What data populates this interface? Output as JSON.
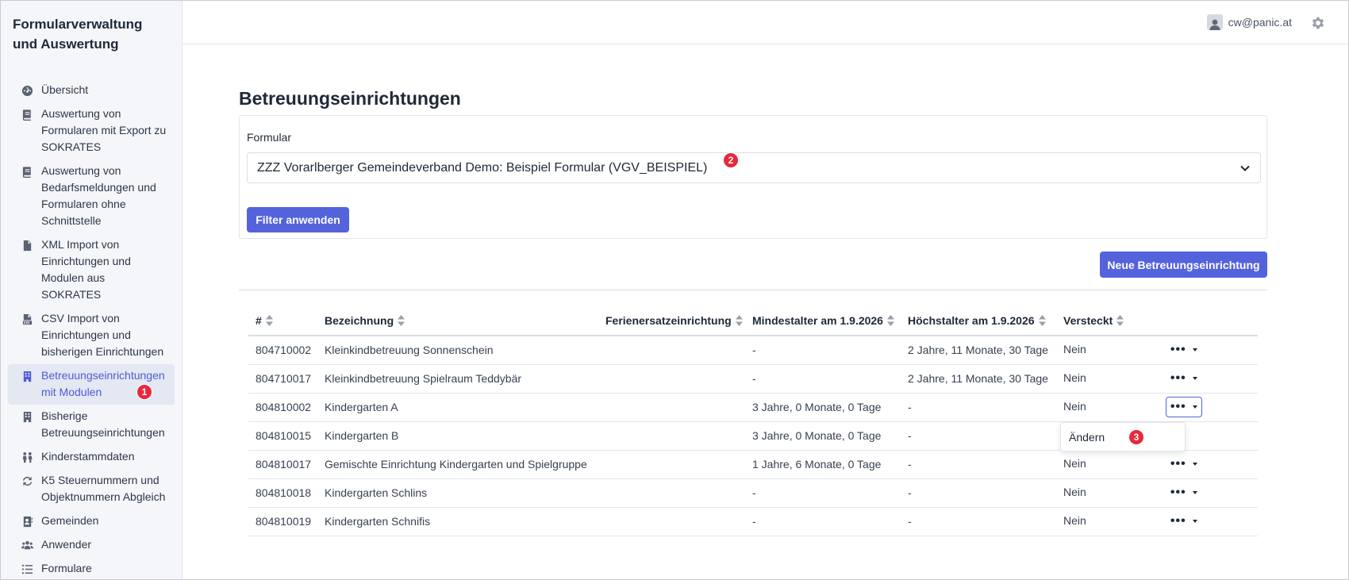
{
  "app": {
    "title": "Formularverwaltung und Auswertung"
  },
  "sidebar": {
    "items": [
      {
        "label": "Übersicht",
        "icon": "dashboard-icon"
      },
      {
        "label": "Auswertung von Formularen mit Export zu SOKRATES",
        "icon": "book-icon"
      },
      {
        "label": "Auswertung von Bedarfsmeldungen und Formularen ohne Schnittstelle",
        "icon": "book-icon"
      },
      {
        "label": "XML Import von Einrichtungen und Modulen aus SOKRATES",
        "icon": "file-code-icon"
      },
      {
        "label": "CSV Import von Einrichtungen und bisherigen Einrichtungen",
        "icon": "file-csv-icon"
      },
      {
        "label": "Betreuungseinrichtungen mit Modulen",
        "icon": "building-icon",
        "active": true,
        "badge": "1"
      },
      {
        "label": "Bisherige Betreuungseinrichtungen",
        "icon": "building-icon"
      },
      {
        "label": "Kinderstammdaten",
        "icon": "children-icon"
      },
      {
        "label": "K5 Steuernummern und Objektnummern Abgleich",
        "icon": "sync-icon"
      },
      {
        "label": "Gemeinden",
        "icon": "address-book-icon"
      },
      {
        "label": "Anwender",
        "icon": "users-icon"
      },
      {
        "label": "Formulare",
        "icon": "list-icon"
      }
    ]
  },
  "header": {
    "user_email": "cw@panic.at",
    "user_icon": "user-icon",
    "settings_icon": "gear-icon"
  },
  "main": {
    "title": "Betreuungseinrichtungen",
    "filter": {
      "label": "Formular",
      "selected": "ZZZ Vorarlberger Gemeindeverband Demo: Beispiel Formular (VGV_BEISPIEL)",
      "badge": "2",
      "apply_label": "Filter anwenden"
    },
    "new_button_label": "Neue Betreuungseinrichtung",
    "table": {
      "columns": [
        "#",
        "Bezeichnung",
        "Ferienersatzeinrichtung",
        "Mindestalter am 1.9.2026",
        "Höchstalter am 1.9.2026",
        "Versteckt"
      ],
      "rows": [
        [
          "804710002",
          "Kleinkindbetreuung Sonnenschein",
          "",
          "-",
          "2 Jahre, 11 Monate, 30 Tage",
          "Nein"
        ],
        [
          "804710017",
          "Kleinkindbetreuung Spielraum Teddybär",
          "",
          "-",
          "2 Jahre, 11 Monate, 30 Tage",
          "Nein"
        ],
        [
          "804810002",
          "Kindergarten A",
          "",
          "3 Jahre, 0 Monate, 0 Tage",
          "-",
          "Nein"
        ],
        [
          "804810015",
          "Kindergarten B",
          "",
          "3 Jahre, 0 Monate, 0 Tage",
          "-",
          ""
        ],
        [
          "804810017",
          "Gemischte Einrichtung Kindergarten und Spielgruppe",
          "",
          "1 Jahre, 6 Monate, 0 Tage",
          "-",
          "Nein"
        ],
        [
          "804810018",
          "Kindergarten Schlins",
          "",
          "-",
          "-",
          "Nein"
        ],
        [
          "804810019",
          "Kindergarten Schnifis",
          "",
          "-",
          "-",
          "Nein"
        ]
      ]
    },
    "dropdown": {
      "item_label": "Ändern",
      "badge": "3"
    }
  }
}
